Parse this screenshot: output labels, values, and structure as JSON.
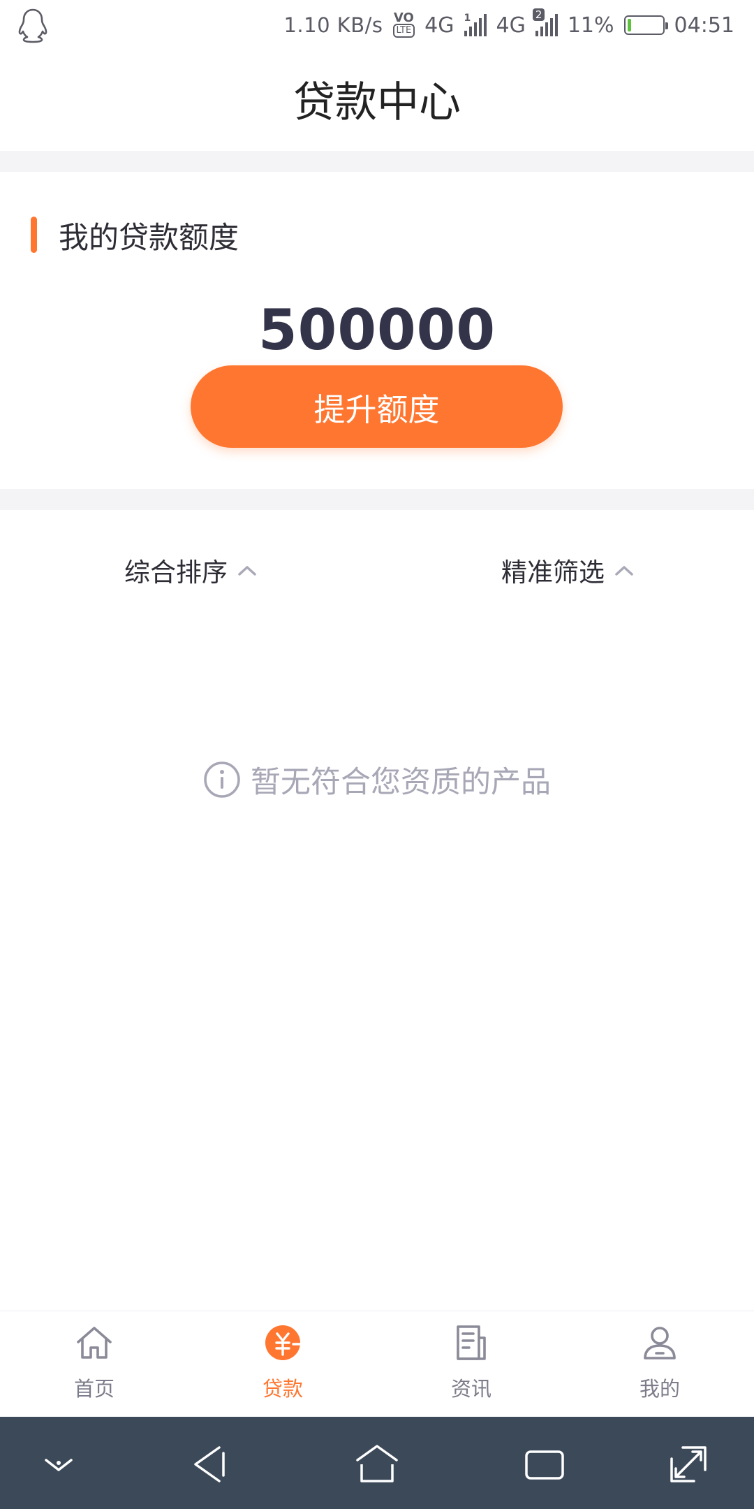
{
  "status_bar": {
    "net_speed": "1.10 KB/s",
    "volte": "VO",
    "lte": "LTE",
    "net1": "4G",
    "sim1_index": "1",
    "net2": "4G",
    "sim2_index": "2",
    "battery": "11%",
    "battery_level": 0.11,
    "time": "04:51",
    "app_icon": "qq-penguin-icon"
  },
  "header": {
    "title": "贷款中心"
  },
  "quota": {
    "title": "我的贷款额度",
    "value": "500000",
    "raise_label": "提升额度"
  },
  "filters": {
    "sort_label": "综合排序",
    "precise_label": "精准筛选"
  },
  "empty_state": {
    "message": "暂无符合您资质的产品"
  },
  "bottom_nav": {
    "items": [
      {
        "label": "首页",
        "icon": "home-icon",
        "active": false
      },
      {
        "label": "贷款",
        "icon": "yuan-coin-icon",
        "active": true
      },
      {
        "label": "资讯",
        "icon": "news-icon",
        "active": false
      },
      {
        "label": "我的",
        "icon": "user-icon",
        "active": false
      }
    ]
  },
  "system_nav": {
    "icons": [
      "collapse-icon",
      "back-icon",
      "home-icon",
      "recents-icon",
      "expand-icon"
    ]
  },
  "colors": {
    "accent": "#ff7630",
    "nav_bar": "#3c4959",
    "separator": "#f4f4f7",
    "muted_text": "#a7a7b6"
  }
}
